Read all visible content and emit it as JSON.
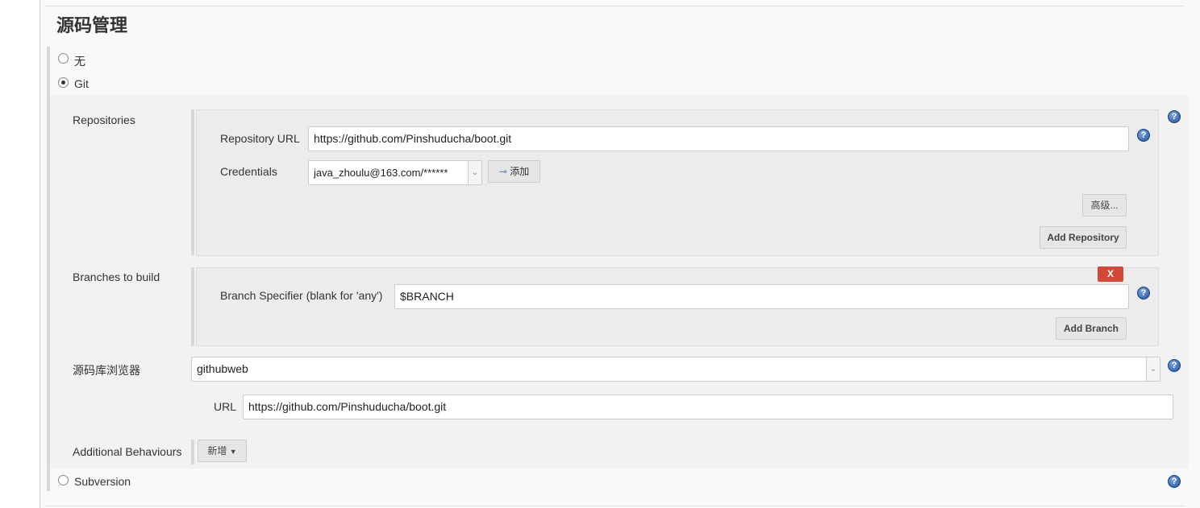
{
  "section_title": "源码管理",
  "scm_options": [
    {
      "label": "无",
      "selected": false
    },
    {
      "label": "Git",
      "selected": true
    },
    {
      "label": "Subversion",
      "selected": false
    }
  ],
  "git": {
    "repositories_label": "Repositories",
    "repository_url_label": "Repository URL",
    "repository_url": "https://github.com/Pinshuducha/boot.git",
    "credentials_label": "Credentials",
    "credentials_value": "java_zhoulu@163.com/******",
    "add_credentials_label": "添加",
    "advanced_label": "高级...",
    "add_repository_label": "Add Repository",
    "branches_label": "Branches to build",
    "delete_branch_label": "X",
    "branch_specifier_label": "Branch Specifier (blank for 'any')",
    "branch_specifier": "$BRANCH",
    "add_branch_label": "Add Branch",
    "repo_browser_label": "源码库浏览器",
    "repo_browser_value": "githubweb",
    "browser_url_label": "URL",
    "browser_url": "https://github.com/Pinshuducha/boot.git",
    "additional_behaviours_label": "Additional Behaviours",
    "add_behaviour_label": "新增"
  },
  "help_icon": "?",
  "colors": {
    "delete": "#d24939",
    "help": "#2a5aa8"
  }
}
